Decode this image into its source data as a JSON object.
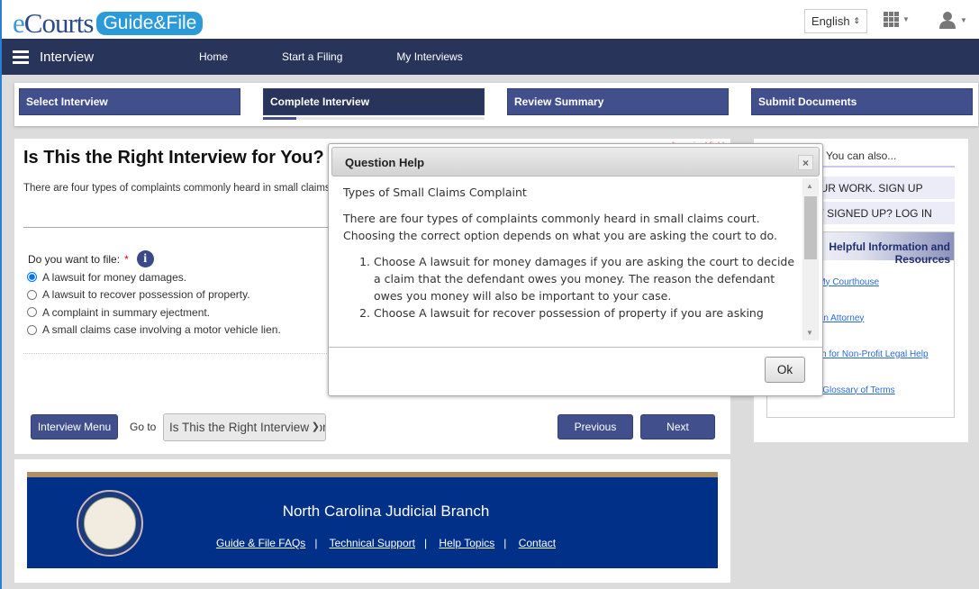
{
  "header": {
    "logo_text": "eCourts",
    "logo_badge": "Guide&File",
    "language": "English"
  },
  "nav": {
    "title": "Interview",
    "links": [
      "Home",
      "Start a Filing",
      "My Interviews"
    ]
  },
  "steps": {
    "items": [
      "Select Interview",
      "Complete Interview",
      "Review Summary",
      "Submit Documents"
    ],
    "active": 1,
    "progress_percent": 15
  },
  "main": {
    "title": "Is This the Right Interview for You?",
    "required_note": "* required field",
    "intro": "There are four types of complaints commonly heard in small claims court. Choosing the correct option depends on what you are asking the court to do.",
    "question": "Do you want to file:",
    "required_star": "*",
    "options": [
      "A lawsuit for money damages.",
      "A lawsuit to recover possession of property.",
      "A complaint in summary ejectment.",
      "A small claims case involving a motor vehicle lien."
    ],
    "selected": 0,
    "interview_menu": "Interview Menu",
    "goto_label": "Go to",
    "goto_value": "Is This the Right Interview for You?",
    "previous": "Previous",
    "next": "Next"
  },
  "sidebar": {
    "also": "You can also...",
    "signup": "SAVE YOUR WORK. SIGN UP",
    "login": "ALREADY SIGNED UP? LOG IN",
    "resources_title": "Helpful Information and Resources",
    "links": [
      "Find My Courthouse",
      "Find An Attorney",
      "Search for Non-Profit Legal Help",
      "Legal Glossary of Terms"
    ]
  },
  "footer": {
    "title": "North Carolina Judicial Branch",
    "seal_text": "Judicial Branch of North Carolina - General Court of Justice",
    "links": [
      "Guide & File FAQs",
      "Technical Support",
      "Help Topics",
      "Contact"
    ]
  },
  "dialog": {
    "title": "Question Help",
    "heading": "Types of Small Claims Complaint",
    "para": "There are four types of complaints commonly heard in small claims court. Choosing the correct option depends on what you are asking the court to do.",
    "items": [
      "Choose A lawsuit for money damages if you are asking the court to decide a claim that the defendant owes you money. The reason the defendant owes you money will also be important to your case.",
      "Choose A lawsuit for recover possession of property if you are asking"
    ],
    "close": "×",
    "ok": "Ok"
  }
}
